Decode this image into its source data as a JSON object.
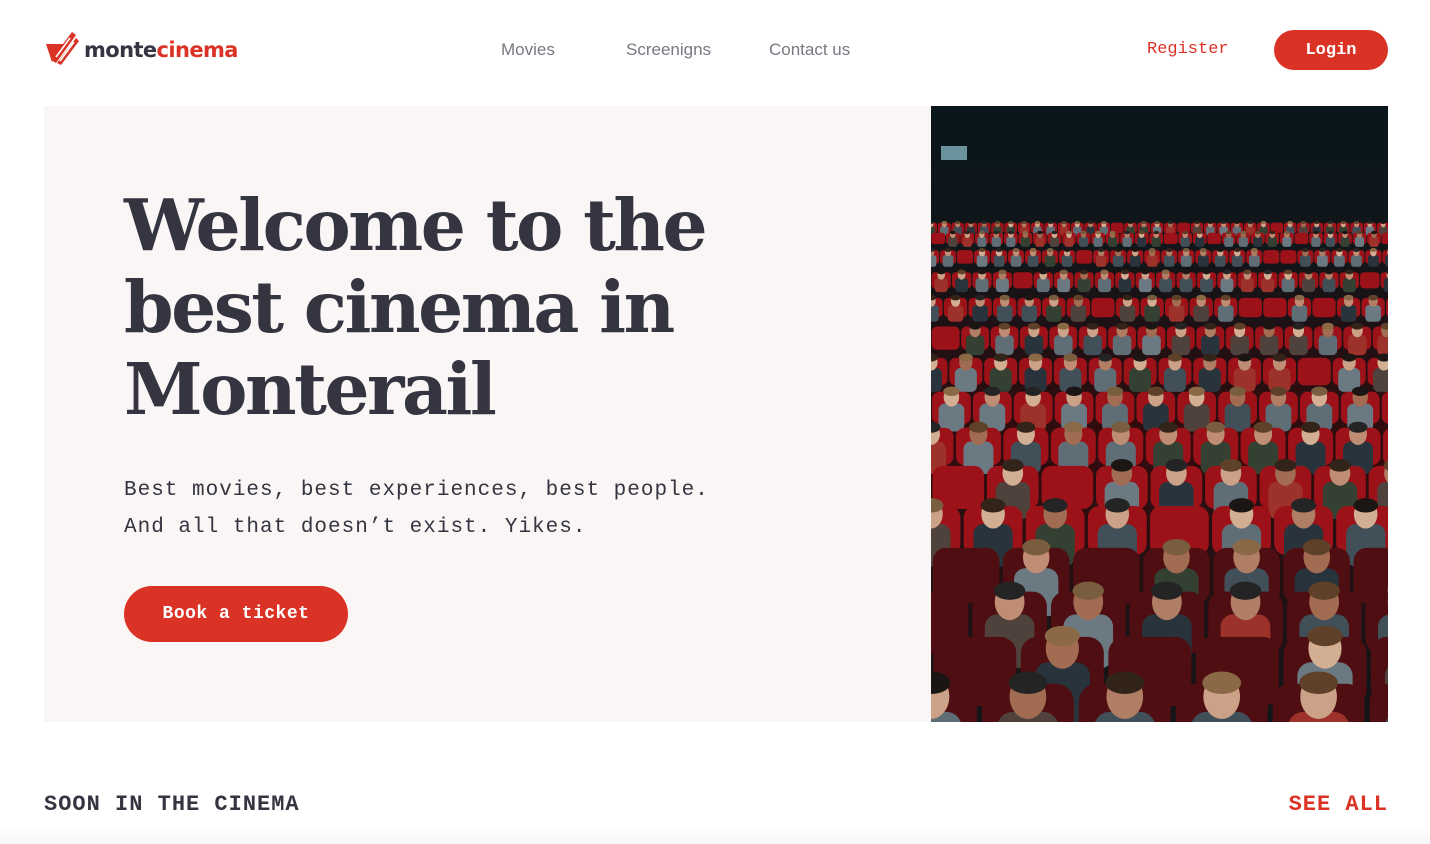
{
  "brand": {
    "name_part1": "monte",
    "name_part2": "cinema",
    "icon": "monte-cinema-logo-icon",
    "accent_color": "#DA3325",
    "text_color": "#343541"
  },
  "nav": {
    "items": [
      {
        "label": "Movies"
      },
      {
        "label": "Screenigns"
      },
      {
        "label": "Contact us"
      }
    ]
  },
  "auth": {
    "register_label": "Register",
    "login_label": "Login"
  },
  "hero": {
    "title": "Welcome to the best cinema in Monterail",
    "subtitle_line1": "Best movies, best experiences, best people.",
    "subtitle_line2": "And all that doesn’t exist. Yikes.",
    "cta_label": "Book a ticket",
    "background_color": "#FBF6F6",
    "photo": "cinema-audience-photo"
  },
  "soon": {
    "title": "SOON IN THE CINEMA",
    "see_all_label": "SEE ALL"
  }
}
